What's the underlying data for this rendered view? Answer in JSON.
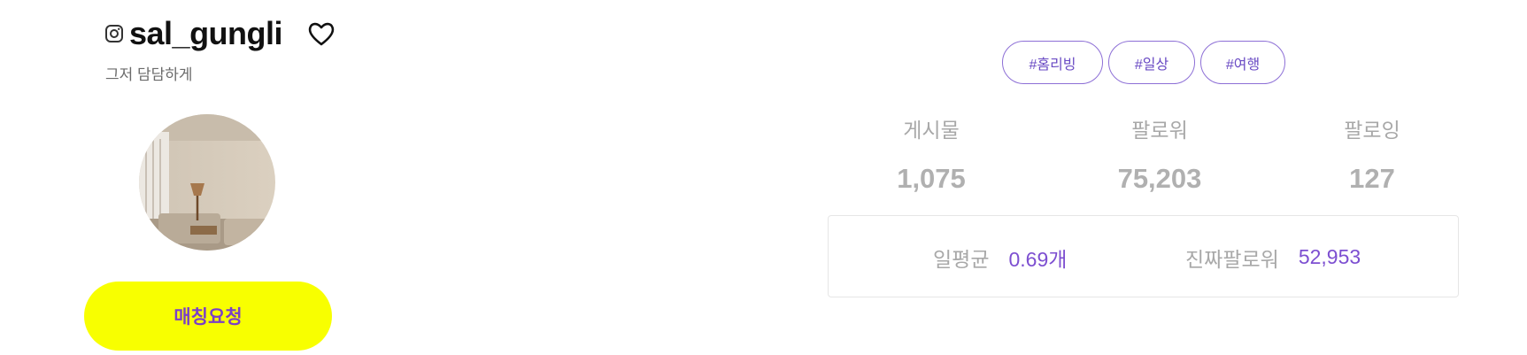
{
  "profile": {
    "username": "sal_gungli",
    "bio": "그저 담담하게",
    "match_button_label": "매칭요청"
  },
  "tags": [
    {
      "label": "#홈리빙"
    },
    {
      "label": "#일상"
    },
    {
      "label": "#여행"
    }
  ],
  "stats": [
    {
      "label": "게시물",
      "value": "1,075"
    },
    {
      "label": "팔로워",
      "value": "75,203"
    },
    {
      "label": "팔로잉",
      "value": "127"
    }
  ],
  "summary": {
    "daily_avg_label": "일평균",
    "daily_avg_value": "0.69개",
    "real_followers_label": "진짜팔로워",
    "real_followers_value": "52,953"
  },
  "icons": {
    "platform": "instagram-icon",
    "favorite": "heart-icon"
  },
  "colors": {
    "accent_purple": "#7d4fd1",
    "button_yellow": "#f8ff00",
    "muted_gray": "#a8a8a8"
  }
}
